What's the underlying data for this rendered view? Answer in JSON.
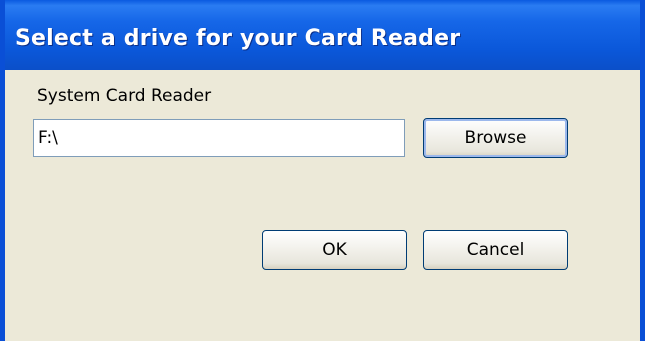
{
  "window": {
    "title": "Select a drive for your Card Reader"
  },
  "form": {
    "label": "System Card Reader",
    "path_value": "F:\\"
  },
  "buttons": {
    "browse_label": "Browse",
    "ok_label": "OK",
    "cancel_label": "Cancel"
  },
  "colors": {
    "titlebar": "#0b58da",
    "dialog_background": "#ece9d8",
    "button_border": "#003c74"
  }
}
